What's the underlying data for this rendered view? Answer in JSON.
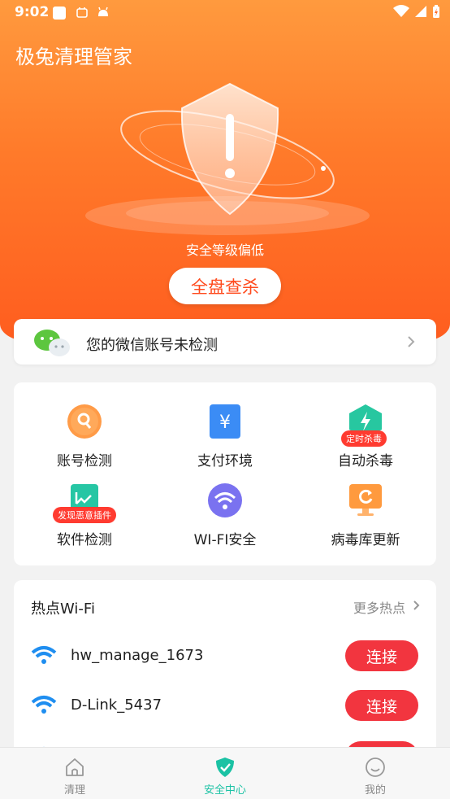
{
  "status_bar": {
    "time": "9:02"
  },
  "app": {
    "title": "极兔清理管家"
  },
  "hero": {
    "level_text": "安全等级偏低",
    "scan_button": "全盘查杀"
  },
  "wechat_card": {
    "text": "您的微信账号未检测"
  },
  "features": [
    {
      "label": "账号检测",
      "icon": "key-search-icon"
    },
    {
      "label": "支付环境",
      "icon": "yuan-icon"
    },
    {
      "label": "自动杀毒",
      "icon": "lightning-icon",
      "badge": "定时杀毒"
    },
    {
      "label": "软件检测",
      "icon": "chart-icon",
      "badge": "发现恶意插件"
    },
    {
      "label": "WI-FI安全",
      "icon": "wifi-icon"
    },
    {
      "label": "病毒库更新",
      "icon": "refresh-monitor-icon"
    }
  ],
  "hotspots": {
    "title": "热点Wi-Fi",
    "more": "更多热点",
    "items": [
      {
        "name": "hw_manage_1673",
        "button": "连接"
      },
      {
        "name": "D-Link_5437",
        "button": "连接"
      },
      {
        "name": "",
        "button": "连接"
      }
    ]
  },
  "tabs": [
    {
      "label": "清理",
      "icon": "home-icon"
    },
    {
      "label": "安全中心",
      "icon": "shield-check-icon"
    },
    {
      "label": "我的",
      "icon": "smile-icon"
    }
  ],
  "colors": {
    "hero_top": "#ff9a3e",
    "hero_bottom": "#ff5d1f",
    "connect_red": "#f2353f",
    "accent_teal": "#1bc2a4"
  }
}
